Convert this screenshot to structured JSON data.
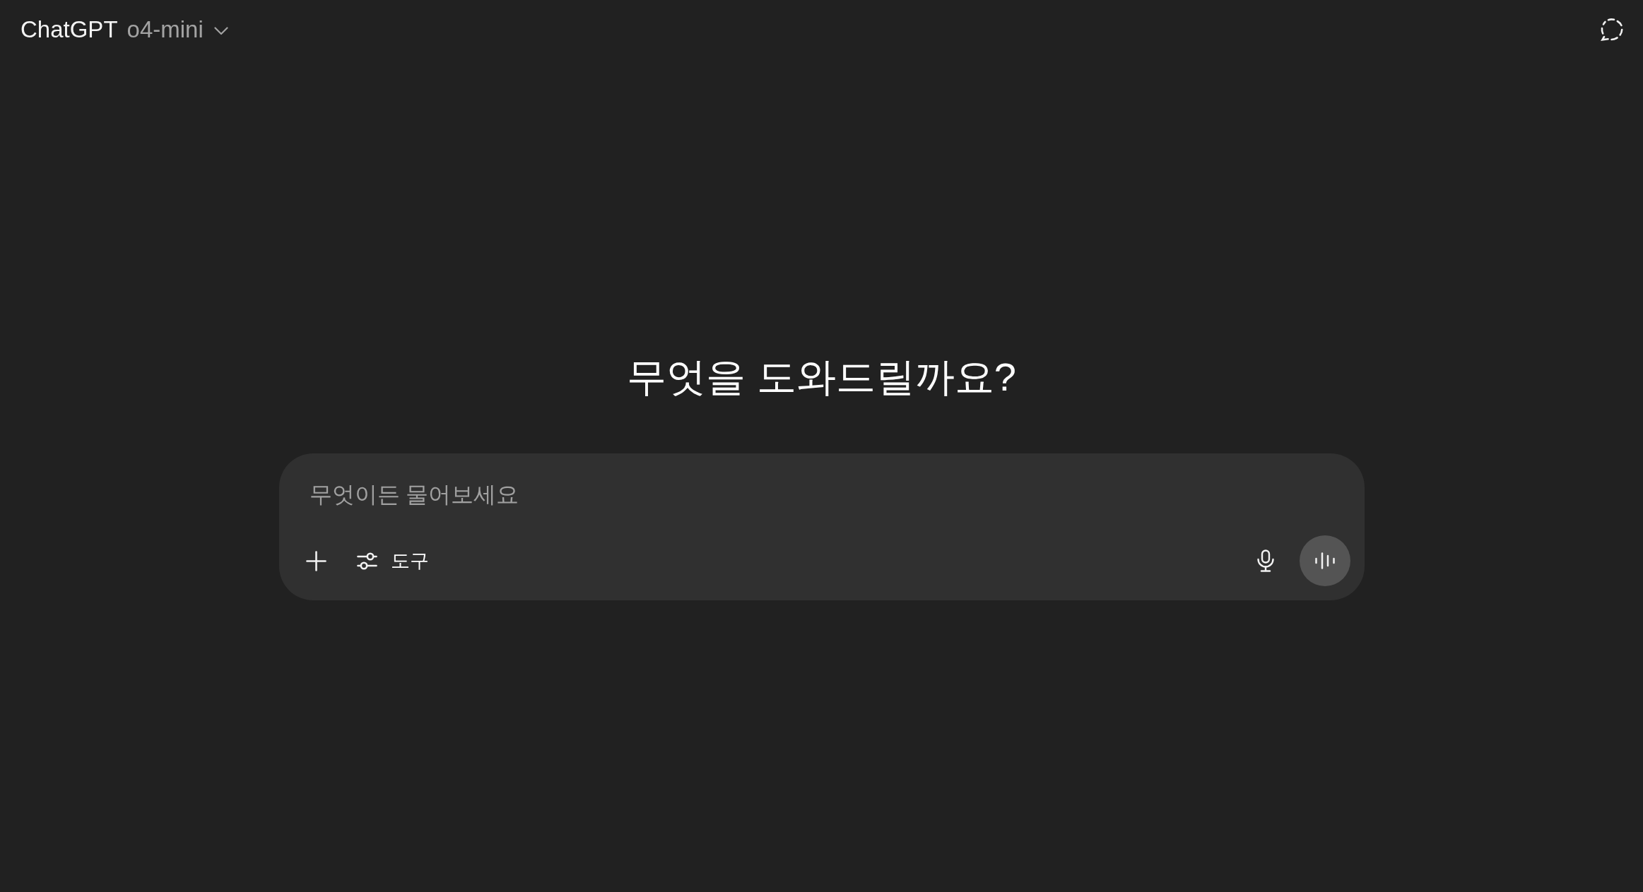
{
  "header": {
    "title": "ChatGPT",
    "model": "o4-mini"
  },
  "heading": "무엇을 도와드릴까요?",
  "composer": {
    "placeholder": "무엇이든 물어보세요",
    "tools_label": "도구"
  }
}
